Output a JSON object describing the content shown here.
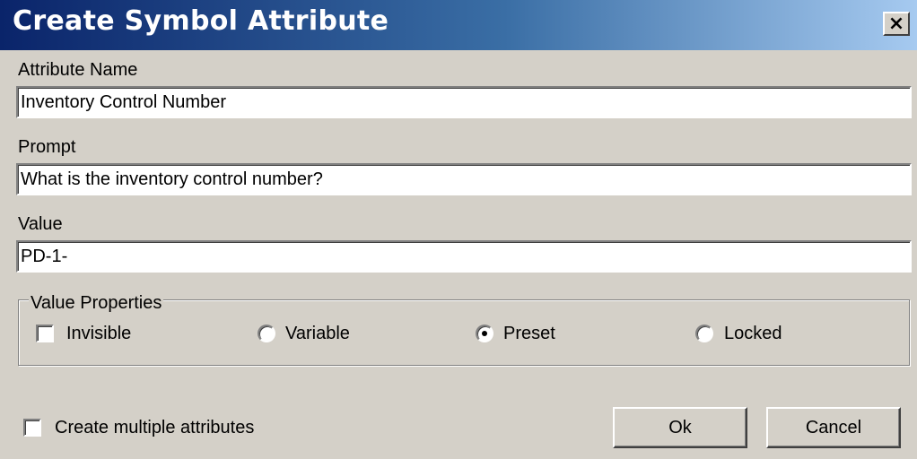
{
  "window": {
    "title": "Create Symbol Attribute",
    "close_glyph": "×"
  },
  "fields": {
    "attribute_name": {
      "label": "Attribute Name",
      "value": "Inventory Control Number"
    },
    "prompt": {
      "label": "Prompt",
      "value": "What is the inventory control number?"
    },
    "value": {
      "label": "Value",
      "value": "PD-1-"
    }
  },
  "value_properties": {
    "legend": "Value Properties",
    "invisible": {
      "label": "Invisible",
      "checked": false
    },
    "options": [
      {
        "label": "Variable",
        "selected": false
      },
      {
        "label": "Preset",
        "selected": true
      },
      {
        "label": "Locked",
        "selected": false
      }
    ]
  },
  "footer": {
    "create_multiple": {
      "label": "Create multiple attributes",
      "checked": false
    },
    "ok_label": "Ok",
    "cancel_label": "Cancel"
  },
  "colors": {
    "dialog_face": "#d4d0c8",
    "title_gradient_start": "#0a246a",
    "title_gradient_end": "#a6caf0"
  }
}
